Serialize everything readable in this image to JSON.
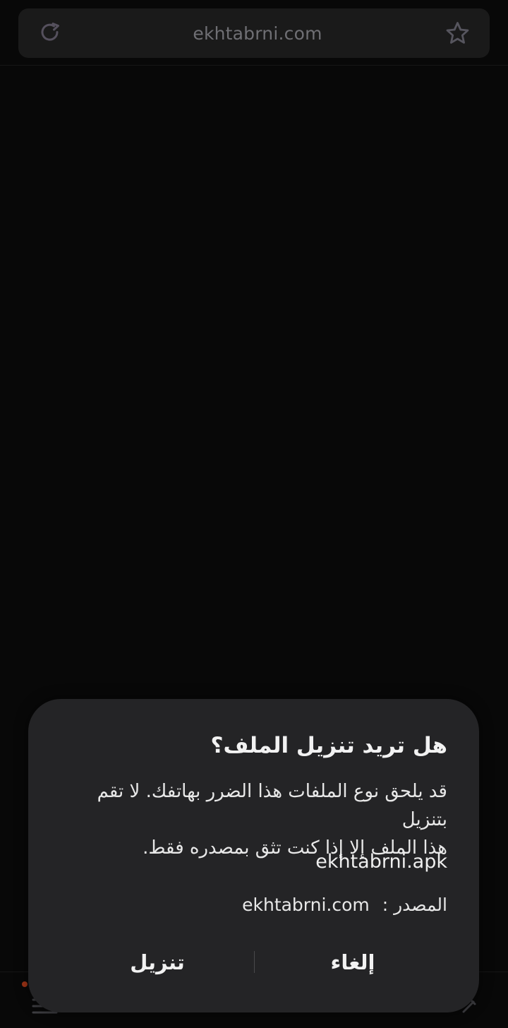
{
  "browser": {
    "url": "ekhtabrni.com",
    "icons": {
      "reload": "reload-icon",
      "bookmark": "star-icon"
    }
  },
  "dialog": {
    "title": "هل تريد تنزيل الملف؟",
    "message_line_1": "قد يلحق نوع الملفات هذا الضرر بهاتفك. لا تقم بتنزيل",
    "message_line_2": "هذا الملف إلا إذا كنت تثق بمصدره فقط.",
    "filename": "ekhtabrni.apk",
    "source_label": "المصدر :",
    "source_url": "ekhtabrni.com",
    "download_label": "تنزيل",
    "cancel_label": "إلغاء"
  },
  "bottom_nav": {
    "icons": {
      "menu": "menu-icon",
      "edit": "edit-icon"
    }
  },
  "colors": {
    "background": "#080808",
    "address_bar": "#1a1a1a",
    "dialog": "#242426",
    "text": "#f2f2f2",
    "muted_text": "#6f6f74",
    "notification": "#9d3316"
  }
}
